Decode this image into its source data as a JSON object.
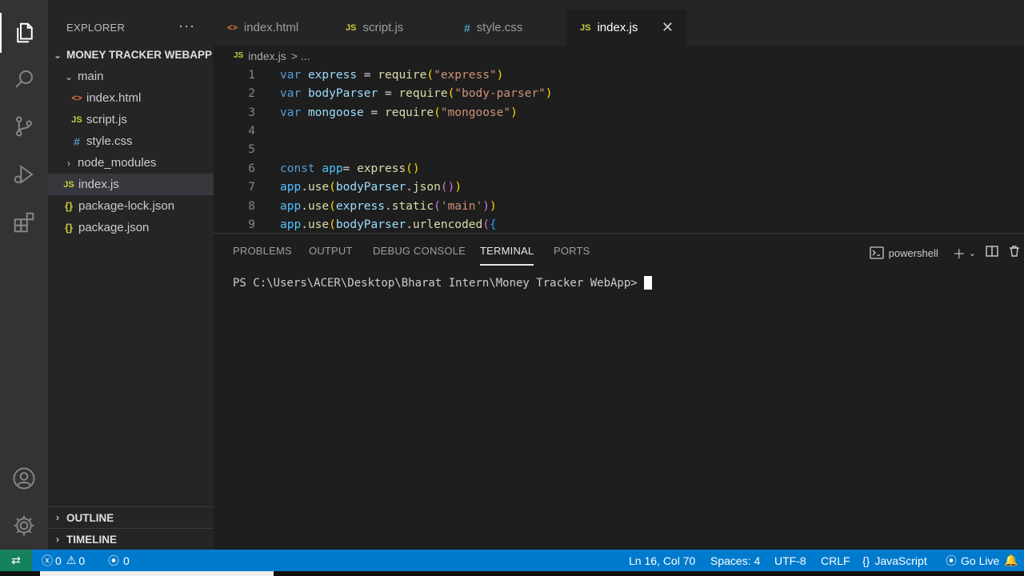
{
  "explorer": {
    "title": "EXPLORER",
    "more": "···",
    "project": "MONEY TRACKER WEBAPP",
    "tree": [
      {
        "label": "main",
        "icon": "chevron-down"
      },
      {
        "label": "index.html",
        "icon": "html-file-icon"
      },
      {
        "label": "script.js",
        "icon": "js-file-icon"
      },
      {
        "label": "style.css",
        "icon": "css-file-icon"
      },
      {
        "label": "node_modules",
        "icon": "chevron-right"
      },
      {
        "label": "index.js",
        "icon": "js-file-icon"
      },
      {
        "label": "package-lock.json",
        "icon": "json-file-icon"
      },
      {
        "label": "package.json",
        "icon": "json-file-icon"
      }
    ],
    "outline": "OUTLINE",
    "timeline": "TIMELINE"
  },
  "tabs": [
    {
      "label": "index.html",
      "icon": "<>"
    },
    {
      "label": "script.js",
      "icon": "JS"
    },
    {
      "label": "style.css",
      "icon": "#"
    },
    {
      "label": "index.js",
      "icon": "JS",
      "active": true
    }
  ],
  "breadcrumb": {
    "file": "index.js",
    "rest": "> ..."
  },
  "editor": {
    "line_numbers": [
      "1",
      "2",
      "3",
      "4",
      "5",
      "6",
      "7",
      "8",
      "9"
    ]
  },
  "panel": {
    "tabs": [
      "PROBLEMS",
      "OUTPUT",
      "DEBUG CONSOLE",
      "TERMINAL",
      "PORTS"
    ],
    "active_tab": "TERMINAL",
    "shell": "powershell",
    "prompt": "PS C:\\Users\\ACER\\Desktop\\Bharat Intern\\Money Tracker WebApp>"
  },
  "statusbar": {
    "errors": "0",
    "warnings": "0",
    "ports": "0",
    "position": "Ln 16, Col 70",
    "spaces": "Spaces: 4",
    "encoding": "UTF-8",
    "eol": "CRLF",
    "language": "JavaScript",
    "golive": "Go Live"
  },
  "colors": {
    "accent": "#007acc",
    "remote": "#16825d",
    "sidebar": "#252526",
    "editor": "#1e1e1e"
  }
}
